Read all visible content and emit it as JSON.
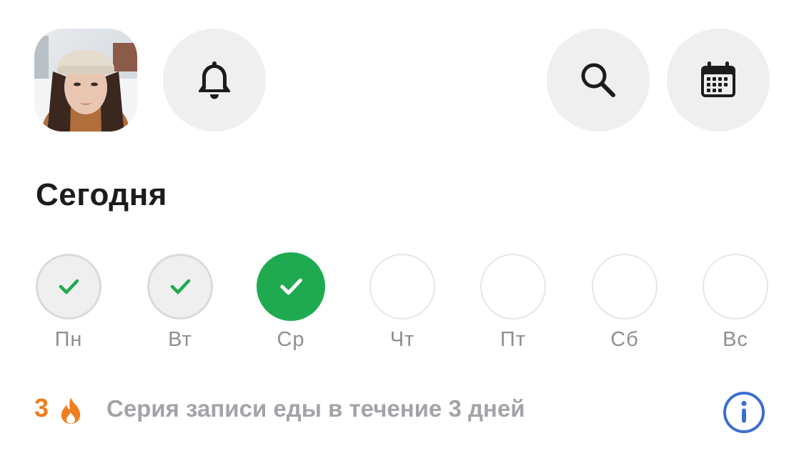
{
  "header": {
    "avatar_icon": "user-avatar-photo",
    "bell_icon": "bell-icon",
    "search_icon": "search-icon",
    "calendar_icon": "calendar-icon",
    "button_bg": "#efeff0"
  },
  "title": "Сегодня",
  "week": {
    "days": [
      {
        "label": "Пн",
        "state": "done"
      },
      {
        "label": "Вт",
        "state": "done"
      },
      {
        "label": "Ср",
        "state": "today-done"
      },
      {
        "label": "Чт",
        "state": "empty"
      },
      {
        "label": "Пт",
        "state": "empty"
      },
      {
        "label": "Сб",
        "state": "empty"
      },
      {
        "label": "Вс",
        "state": "empty"
      }
    ],
    "check_color": "#1faa50",
    "today_color": "#1faa50"
  },
  "streak": {
    "count": "3",
    "flame_icon": "flame-icon",
    "text": "Серия записи еды в течение 3 дней",
    "info_icon": "info-icon",
    "count_color": "#f07d1e",
    "info_color": "#3d6fcc"
  }
}
